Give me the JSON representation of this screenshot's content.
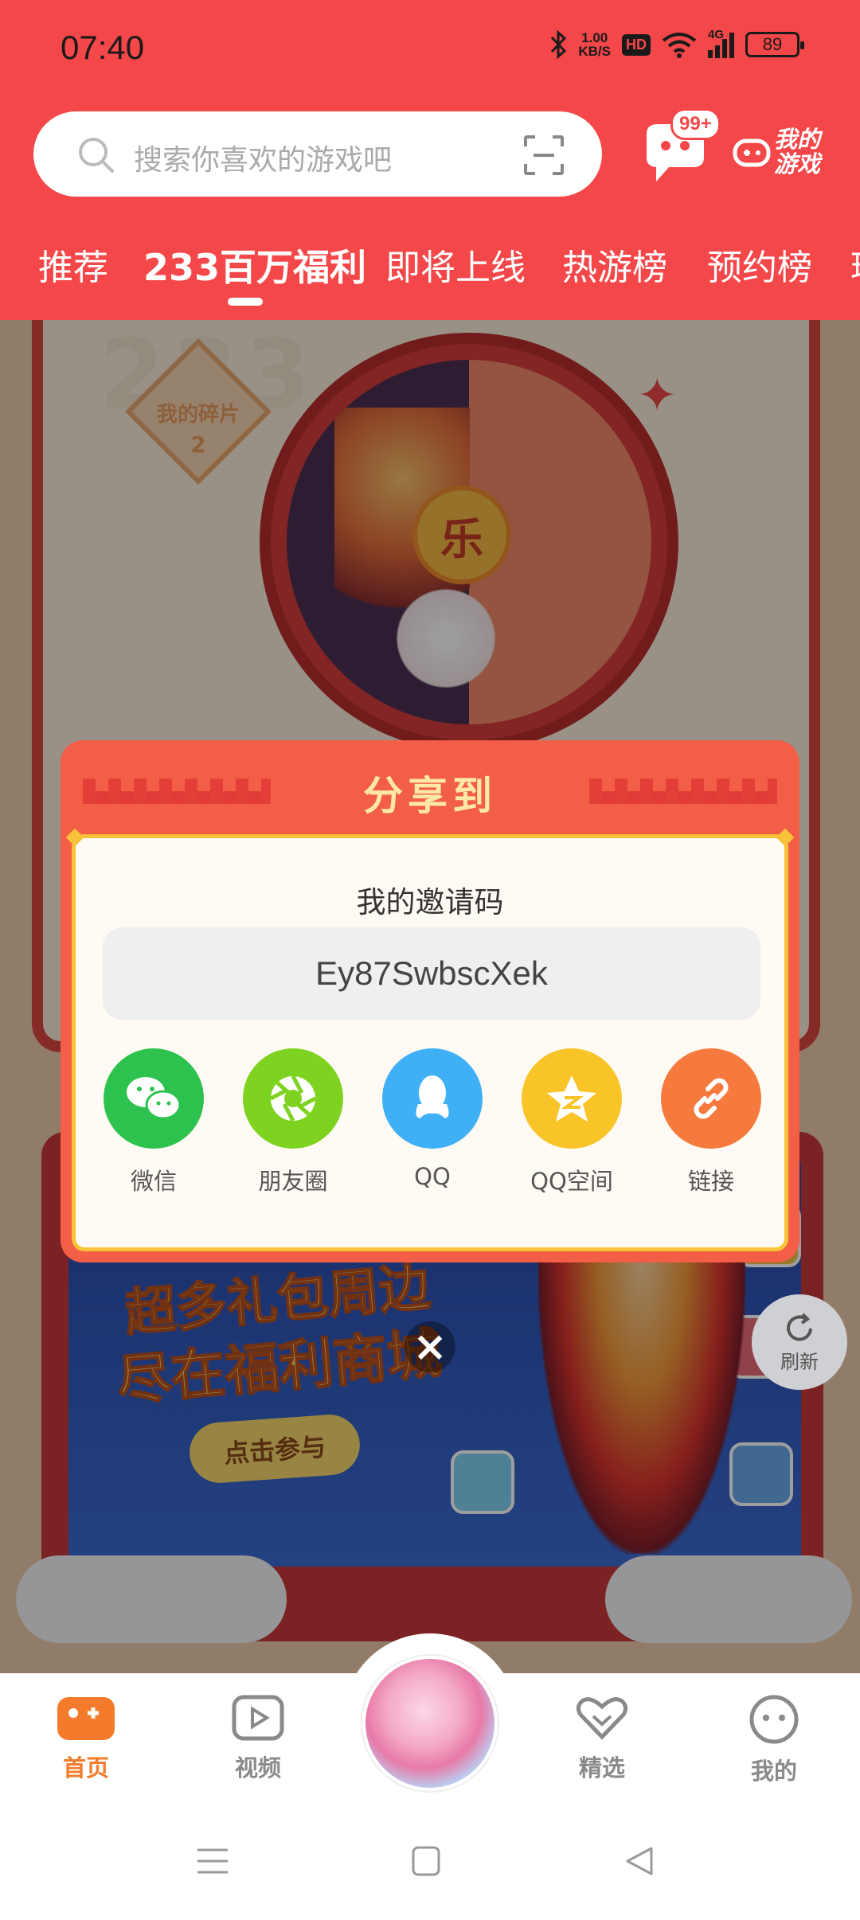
{
  "status_bar": {
    "time": "07:40",
    "net_speed_top": "1.00",
    "net_speed_bottom": "KB/S",
    "hd": "HD",
    "signal": "4G",
    "battery": "89"
  },
  "search": {
    "placeholder": "搜索你喜欢的游戏吧"
  },
  "header": {
    "message_badge": "99+",
    "my_games_line1": "我的",
    "my_games_line2": "游戏"
  },
  "tabs": [
    {
      "label": "推荐"
    },
    {
      "label": "233百万福利"
    },
    {
      "label": "即将上线"
    },
    {
      "label": "热游榜"
    },
    {
      "label": "预约榜"
    },
    {
      "label": "璃"
    }
  ],
  "background": {
    "fragment_label": "我的碎片",
    "fragment_count": "2",
    "wheel_center": "乐",
    "banner_line1": "超多礼包周边",
    "banner_line2": "尽在福利商城",
    "banner_cta": "点击参与",
    "refresh_label": "刷新"
  },
  "share_dialog": {
    "title": "分享到",
    "code_label": "我的邀请码",
    "invite_code": "Ey87SwbscXek",
    "targets": [
      {
        "label": "微信",
        "icon": "wechat-icon",
        "color": "#2dc24e"
      },
      {
        "label": "朋友圈",
        "icon": "moments-icon",
        "color": "#7ed321"
      },
      {
        "label": "QQ",
        "icon": "qq-icon",
        "color": "#3fb0f5"
      },
      {
        "label": "QQ空间",
        "icon": "qzone-icon",
        "color": "#f8c428"
      },
      {
        "label": "链接",
        "icon": "link-icon",
        "color": "#f67a3d"
      }
    ],
    "close": "×"
  },
  "bottom_nav": [
    {
      "label": "首页",
      "icon": "gamepad-icon",
      "active": true
    },
    {
      "label": "视频",
      "icon": "video-icon",
      "active": false
    },
    {
      "label": "精选",
      "icon": "heart-icon",
      "active": false
    },
    {
      "label": "我的",
      "icon": "face-icon",
      "active": false
    }
  ],
  "colors": {
    "brand_red": "#f4474a",
    "active_nav": "#f37b2b",
    "dialog_red": "#f35e47",
    "dialog_gold": "#f8c23a"
  }
}
